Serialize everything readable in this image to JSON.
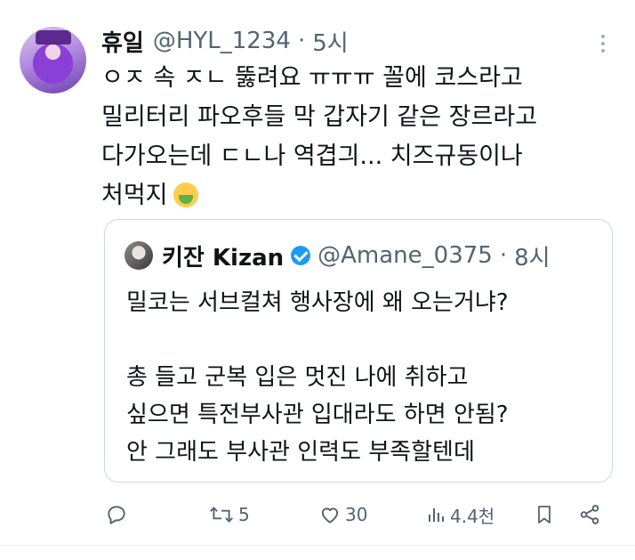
{
  "tweet": {
    "author_name": "휴일",
    "author_handle": "@HYL_1234",
    "separator": "·",
    "time": "5시",
    "lines": [
      "ㅇㅈ 속 ㅈㄴ 뚫려요 ㅠㅠㅠ 꼴에 코스라고",
      "밀리터리 파오후들 막 갑자기 같은 장르라고",
      "다가오는데 ㄷㄴ나 역겹긔...  치즈규동이나",
      "처먹지"
    ],
    "emoji": "nauseated-face-emoji"
  },
  "quote": {
    "author_name": "키잔 Kizan",
    "author_handle": "@Amane_0375",
    "separator": "·",
    "time": "8시",
    "lines": [
      "밀코는 서브컬쳐 행사장에 왜 오는거냐?",
      "",
      "총 들고 군복 입은 멋진 나에 취하고",
      "싶으면 특전부사관 입대라도 하면 안됨?",
      "안 그래도 부사관 인력도 부족할텐데"
    ]
  },
  "actions": {
    "reply_count": "",
    "retweet_count": "5",
    "like_count": "30",
    "views_count": "4.4천"
  },
  "colors": {
    "text": "#0f1419",
    "secondary": "#536471",
    "border": "#cfd9de",
    "verified": "#1d9bf0"
  }
}
